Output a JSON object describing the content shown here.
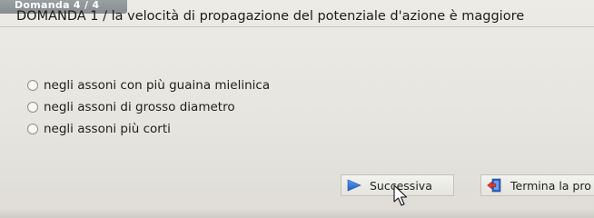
{
  "header": {
    "counter": "Domanda 4 / 4"
  },
  "question": {
    "text": "DOMANDA 1 / la velocità di propagazione del potenziale d'azione è maggiore"
  },
  "options": [
    {
      "label": "negli assoni con più guaina mielinica",
      "selected": false
    },
    {
      "label": "negli assoni di grosso diametro",
      "selected": false
    },
    {
      "label": "negli assoni più corti",
      "selected": false
    }
  ],
  "buttons": {
    "next_label": "Successiva",
    "finish_label": "Termina la pro"
  },
  "colors": {
    "counter_bar": "#8f9597",
    "next_icon": "#2d6fd6",
    "finish_icon_red": "#d93c2f",
    "finish_icon_blue": "#2b63c4"
  },
  "icons": {
    "next": "arrow-right-icon",
    "finish": "exit-icon",
    "cursor": "mouse-pointer-icon"
  }
}
